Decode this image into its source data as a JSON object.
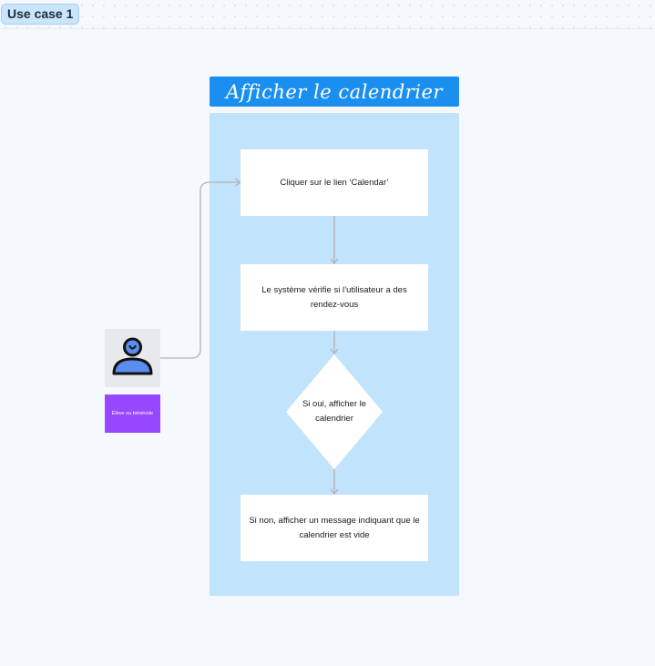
{
  "frame": {
    "label": "Use case 1"
  },
  "diagram": {
    "title": "Afficher le calendrier",
    "steps": [
      "Cliquer sur le lien ‘Calendar’",
      "Le système vérifie si l’utilisateur a des rendez-vous"
    ],
    "decision": "Si oui, afficher le calendrier",
    "fallback": "Si non, afficher un message indiquant que le calendrier est vide"
  },
  "actor": {
    "icon": "user-icon",
    "role": "Élève ou bénévole"
  },
  "colors": {
    "title_bar": "#1b8ff0",
    "container": "#c1e3fc",
    "role_badge": "#9747ff",
    "connector": "#b3b3b3",
    "person_fill": "#5b8def"
  }
}
